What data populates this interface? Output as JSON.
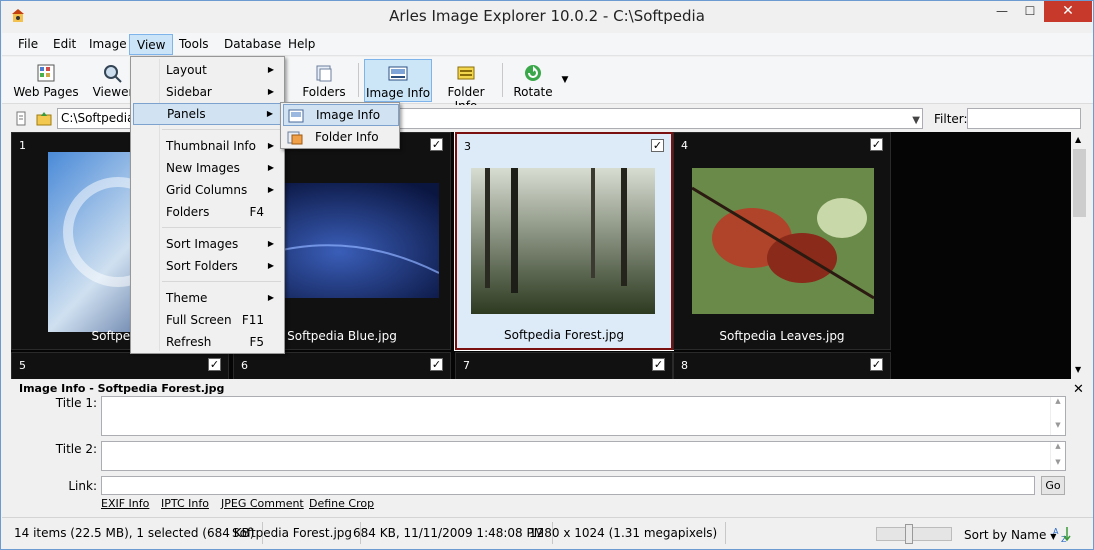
{
  "window": {
    "title": "Arles Image Explorer 10.0.2 - C:\\Softpedia",
    "minimize": "—",
    "maximize": "☐",
    "close": "✕"
  },
  "menubar": [
    "File",
    "Edit",
    "Image",
    "View",
    "Tools",
    "Database",
    "Help"
  ],
  "toolbar": {
    "web_pages": "Web Pages",
    "viewer": "Viewer",
    "folders": "Folders",
    "image_info": "Image Info",
    "folder_info": "Folder Info",
    "rotate": "Rotate"
  },
  "address": {
    "path": "C:\\Softpedia",
    "filter_label": "Filter:",
    "filter_value": ""
  },
  "view_menu": {
    "items": [
      {
        "label": "Layout",
        "submenu": true
      },
      {
        "label": "Sidebar",
        "submenu": true
      },
      {
        "label": "Panels",
        "submenu": true
      },
      {
        "label": "Thumbnail Info",
        "submenu": true
      },
      {
        "label": "New Images",
        "submenu": true
      },
      {
        "label": "Grid Columns",
        "submenu": true
      },
      {
        "label": "Folders",
        "shortcut": "F4"
      },
      {
        "label": "Sort Images",
        "submenu": true
      },
      {
        "label": "Sort Folders",
        "submenu": true
      },
      {
        "label": "Theme",
        "submenu": true
      },
      {
        "label": "Full Screen",
        "shortcut": "F11"
      },
      {
        "label": "Refresh",
        "shortcut": "F5"
      }
    ]
  },
  "panels_menu": {
    "items": [
      "Image Info",
      "Folder Info"
    ]
  },
  "thumbnails": [
    {
      "num": "1",
      "caption": "Softpedia",
      "checked": true
    },
    {
      "num": "2",
      "caption": "Softpedia Blue.jpg",
      "checked": true
    },
    {
      "num": "3",
      "caption": "Softpedia Forest.jpg",
      "checked": true,
      "selected": true
    },
    {
      "num": "4",
      "caption": "Softpedia Leaves.jpg",
      "checked": true
    },
    {
      "num": "5",
      "checked": true
    },
    {
      "num": "6",
      "checked": true
    },
    {
      "num": "7",
      "checked": true
    },
    {
      "num": "8",
      "checked": true
    }
  ],
  "info_panel": {
    "title": "Image Info - Softpedia Forest.jpg",
    "title1_label": "Title 1:",
    "title2_label": "Title 2:",
    "link_label": "Link:",
    "go": "Go",
    "links": [
      "EXIF Info",
      "IPTC Info",
      "JPEG Comment",
      "Define Crop"
    ]
  },
  "status": {
    "count": "14 items (22.5 MB), 1 selected (684 KB)",
    "file": "Softpedia Forest.jpg",
    "size_date": "684 KB, 11/11/2009 1:48:08 PM",
    "dimensions": "1280 x 1024 (1.31 megapixels)",
    "sort": "Sort by Name"
  },
  "colors": {
    "accent_selected": "#7b1010",
    "menu_highlight": "#d1e2f2",
    "close_button": "#c7392b"
  }
}
